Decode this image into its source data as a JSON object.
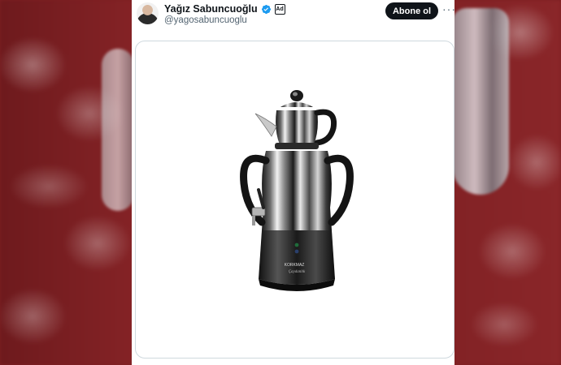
{
  "tweet": {
    "author_name": "Yağız Sabuncuoğlu",
    "handle": "@yagosabuncuoglu",
    "follow_label": "Abone ol",
    "more_label": "···",
    "ad_label": "Ad",
    "product_brand": "KORKMAZ",
    "product_model": "Çaydanlık"
  },
  "icons": {
    "verified": "verified-badge-icon",
    "affiliate": "ad-badge-icon",
    "more": "more-horizontal-icon"
  },
  "colors": {
    "follow_bg": "#0f1419",
    "verified": "#1d9bf0",
    "backdrop": "#7d1f22"
  }
}
